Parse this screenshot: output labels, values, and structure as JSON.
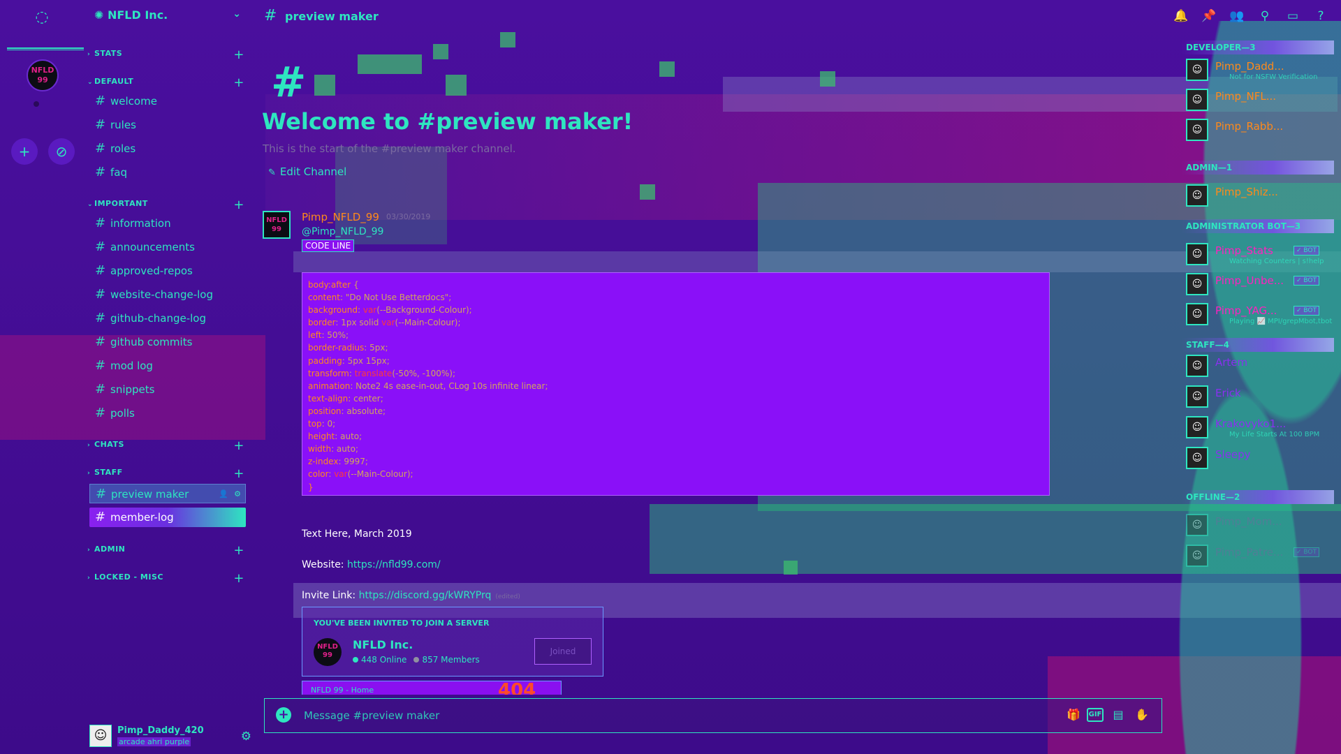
{
  "server": {
    "name": "NFLD Inc.",
    "logo_text": "NFLD 99"
  },
  "rail": {
    "add_label": "+",
    "explore_label": "⊘"
  },
  "categories": [
    {
      "name": "STATS",
      "channels": []
    },
    {
      "name": "DEFAULT",
      "channels": [
        "welcome",
        "rules",
        "roles",
        "faq"
      ]
    },
    {
      "name": "IMPORTANT",
      "channels": [
        "information",
        "announcements",
        "approved-repos",
        "website-change-log",
        "github-change-log",
        "github commits",
        "mod log",
        "snippets",
        "polls"
      ]
    },
    {
      "name": "CHATS",
      "channels": []
    },
    {
      "name": "STAFF",
      "channels": [
        "preview maker",
        "member-log"
      ]
    },
    {
      "name": "ADMIN",
      "channels": []
    },
    {
      "name": "LOCKED - MISC",
      "channels": []
    }
  ],
  "user": {
    "name": "Pimp_Daddy_420",
    "status": "arcade ahri purple"
  },
  "channel": {
    "name": "preview maker",
    "welcome_title": "Welcome to #preview maker!",
    "welcome_sub": "This is the start of the #preview maker channel.",
    "edit_label": "Edit Channel"
  },
  "message": {
    "author": "Pimp_NFLD_99",
    "timestamp": "03/30/2019",
    "mention": "@Pimp_NFLD_99",
    "codeline_badge": "CODE LINE",
    "code": [
      {
        "p": "body:after",
        "v": " {"
      },
      {
        "p": "content",
        "v": ": \"Do Not Use Betterdocs\";"
      },
      {
        "p": "background",
        "v": ": ",
        "fn": "var",
        "v2": "(--Background-Colour);"
      },
      {
        "p": "border",
        "v": ": 1px solid ",
        "fn": "var",
        "v2": "(--Main-Colour);"
      },
      {
        "p": "left",
        "v": ": 50%;"
      },
      {
        "p": "border-radius",
        "v": ": 5px;"
      },
      {
        "p": "padding",
        "v": ": 5px 15px;"
      },
      {
        "p": "transform",
        "v": ": ",
        "fn": "translate",
        "v2": "(-50%, -100%);"
      },
      {
        "p": "animation",
        "v": ": Note2 4s ease-in-out, CLog 10s infinite linear;"
      },
      {
        "p": "text-align",
        "v": ": center;"
      },
      {
        "p": "position",
        "v": ": absolute;"
      },
      {
        "p": "top",
        "v": ": 0;"
      },
      {
        "p": "height",
        "v": ": auto;"
      },
      {
        "p": "width",
        "v": ": auto;"
      },
      {
        "p": "z-index",
        "v": ": 9997;"
      },
      {
        "p": "color",
        "v": ": ",
        "fn": "var",
        "v2": "(--Main-Colour);"
      },
      {
        "p": "}",
        "v": ""
      }
    ],
    "text1": "Text Here, March 2019",
    "website_label": "Website: ",
    "website_url": "https://nfld99.com/",
    "invite_label": "Invite Link: ",
    "invite_url": "https://discord.gg/kWRYPrq",
    "edited": "(edited)",
    "invite_card": {
      "header": "YOU'VE BEEN INVITED TO JOIN A SERVER",
      "name": "NFLD Inc.",
      "online": "448 Online",
      "members": "857 Members",
      "button": "Joined"
    },
    "peek": {
      "text": "NFLD 99 - Home",
      "big": "404"
    }
  },
  "composer": {
    "placeholder": "Message #preview maker",
    "gif_label": "GIF"
  },
  "members": [
    {
      "role": "DEVELOPER—3",
      "list": [
        {
          "name": "Pimp_Dadd...",
          "sub": "Not for NSFW Verification",
          "color": "orange",
          "bot": false
        },
        {
          "name": "Pimp_NFL...",
          "sub": "",
          "color": "orange",
          "bot": false
        },
        {
          "name": "Pimp_Rabb...",
          "sub": "",
          "color": "orange",
          "bot": false
        }
      ]
    },
    {
      "role": "ADMIN—1",
      "list": [
        {
          "name": "Pimp_Shiz...",
          "sub": "",
          "color": "orange",
          "bot": false
        }
      ]
    },
    {
      "role": "ADMINISTRATOR BOT—3",
      "list": [
        {
          "name": "Pimp_Stats",
          "sub": "Watching Counters | s!help",
          "color": "magenta",
          "bot": true
        },
        {
          "name": "Pimp_Unbe...",
          "sub": "",
          "color": "magenta",
          "bot": true
        },
        {
          "name": "Pimp_YAG...",
          "sub": "Playing 📈 MPI/grepMbot,tbot",
          "color": "magenta",
          "bot": true
        }
      ]
    },
    {
      "role": "STAFF—4",
      "list": [
        {
          "name": "Artem",
          "sub": "",
          "color": "purple",
          "bot": false
        },
        {
          "name": "Erick",
          "sub": "",
          "color": "purple",
          "bot": false
        },
        {
          "name": "Krakovyko1...",
          "sub": "My Life Starts At 100 BPM",
          "color": "purple",
          "bot": false
        },
        {
          "name": "Sleepy",
          "sub": "",
          "color": "purple",
          "bot": false
        }
      ]
    },
    {
      "role": "OFFLINE—2",
      "list": [
        {
          "name": "Pimp_Mom...",
          "sub": "",
          "color": "dim",
          "bot": false
        },
        {
          "name": "Pimp_Patre...",
          "sub": "",
          "color": "dim",
          "bot": true
        }
      ]
    }
  ],
  "bot_label": "✓ BOT",
  "colors": {
    "accent": "#2ee6c0",
    "bg": "#4a0f9e",
    "orange": "#ff8a1a",
    "magenta": "#ff20c0",
    "code_bg": "#8a10f8"
  }
}
